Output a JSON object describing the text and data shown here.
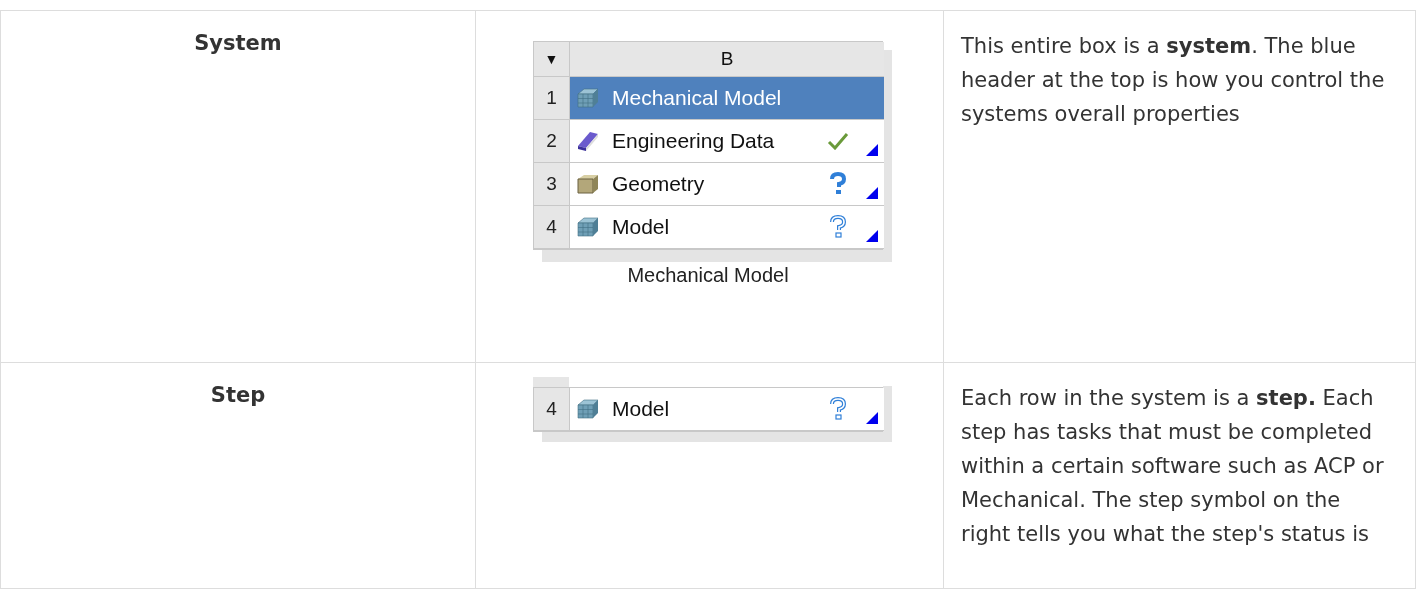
{
  "rows": [
    {
      "term": "System",
      "figure": {
        "kind": "system",
        "menu_glyph": "▼",
        "column_header": "B",
        "caption": "Mechanical Model",
        "cells": [
          {
            "number": "1",
            "label": "Mechanical Model",
            "kind": "cube-grid",
            "selected": true
          },
          {
            "number": "2",
            "label": "Engineering Data",
            "kind": "book",
            "status": {
              "kind": "check"
            },
            "selected": false
          },
          {
            "number": "3",
            "label": "Geometry",
            "kind": "box",
            "status": {
              "kind": "question"
            },
            "selected": false
          },
          {
            "number": "4",
            "label": "Model",
            "kind": "cube-grid",
            "status": {
              "kind": "question-outline"
            },
            "selected": false
          }
        ]
      },
      "description": "This entire box is a **system**. The blue header at the top is how you control the systems overall properties"
    },
    {
      "term": "Step",
      "figure": {
        "kind": "step",
        "cells": [
          {
            "number": "4",
            "label": "Model",
            "kind": "cube-grid",
            "status": {
              "kind": "question-outline"
            },
            "selected": false
          }
        ]
      },
      "description": "Each row in the system is a **step.** Each step has tasks that must be completed within a certain software such as ACP or Mechanical. The step symbol on the right tells you what the step's status is"
    }
  ]
}
